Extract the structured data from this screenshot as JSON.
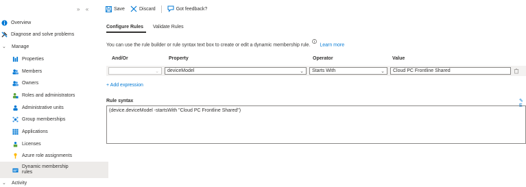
{
  "sidebar": {
    "collapse_glyphs": [
      "»",
      "«"
    ],
    "items": [
      {
        "label": "Overview",
        "icon": "info-icon",
        "color": "#0078d4"
      },
      {
        "label": "Diagnose and solve problems",
        "icon": "wrench-icon",
        "color": "#323130"
      },
      {
        "label": "Manage",
        "icon": "chevron-down-icon",
        "color": "#605e5c"
      },
      {
        "label": "Properties",
        "icon": "properties-icon",
        "color": "#0078d4"
      },
      {
        "label": "Members",
        "icon": "members-icon",
        "color": "#0078d4"
      },
      {
        "label": "Owners",
        "icon": "owners-icon",
        "color": "#0078d4"
      },
      {
        "label": "Roles and administrators",
        "icon": "roles-icon",
        "color": "#0078d4"
      },
      {
        "label": "Administrative units",
        "icon": "admin-units-icon",
        "color": "#0078d4"
      },
      {
        "label": "Group memberships",
        "icon": "group-icon",
        "color": "#0078d4"
      },
      {
        "label": "Applications",
        "icon": "apps-icon",
        "color": "#0078d4"
      },
      {
        "label": "Licenses",
        "icon": "license-icon",
        "color": "#0078d4"
      },
      {
        "label": "Azure role assignments",
        "icon": "key-icon",
        "color": "#ffb900"
      },
      {
        "label": "Dynamic membership rules",
        "icon": "dynamic-rules-icon",
        "color": "#0078d4"
      },
      {
        "label": "Activity",
        "icon": "chevron-down-icon",
        "color": "#605e5c"
      }
    ]
  },
  "toolbar": {
    "save_label": "Save",
    "discard_label": "Discard",
    "feedback_label": "Got feedback?"
  },
  "tabs": {
    "configure": "Configure Rules",
    "validate": "Validate Rules"
  },
  "description": {
    "text": "You can use the rule builder or rule syntax text box to create or edit a dynamic membership rule.",
    "link": "Learn more"
  },
  "table": {
    "headers": {
      "andor": "And/Or",
      "property": "Property",
      "operator": "Operator",
      "value": "Value"
    },
    "row": {
      "andor": "",
      "property": "deviceModel",
      "operator": "Starts With",
      "value": "Cloud PC Frontline Shared"
    }
  },
  "add_expression": "+ Add expression",
  "rule_syntax": {
    "title": "Rule syntax",
    "text": "(device.deviceModel -startsWith \"Cloud PC Frontline Shared\")",
    "edit_glyph": "✎ E"
  },
  "colors": {
    "accent": "#0078d4",
    "selected_bg": "#edebe9"
  }
}
